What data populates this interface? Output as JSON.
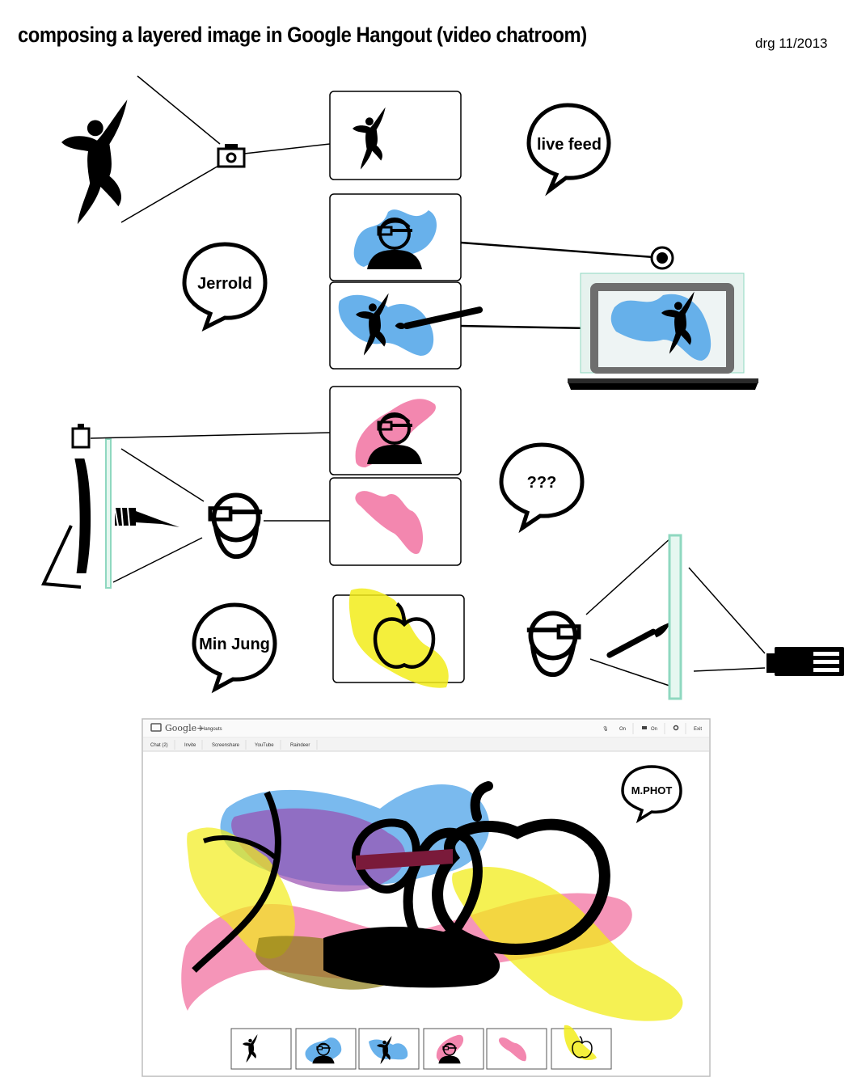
{
  "title": "composing a layered image in Google Hangout (video chatroom)",
  "credit": "drg 11/2013",
  "bubbles": {
    "live_feed": "live feed",
    "jerrold": "Jerrold",
    "unknown": "???",
    "min_jung": "Min Jung",
    "mphot": "M.PHOT"
  },
  "hangout": {
    "brand": "Google+",
    "product": "Hangouts",
    "tabs": [
      "Chat (2)",
      "Invite",
      "Screenshare",
      "YouTube",
      "Raindeer"
    ],
    "controls": {
      "mic": "On",
      "video": "On",
      "exit": "Exit"
    }
  },
  "colors": {
    "blue": "#4da3e8",
    "pink": "#f27aa6",
    "yellow": "#f2ec1a",
    "screen_green": "#8fd8c0",
    "ink": "#000000"
  },
  "icons": [
    "dancer-icon",
    "camera-icon",
    "webcam-icon",
    "laptop-icon",
    "head-with-glasses-icon",
    "paintbrush-icon",
    "apple-icon",
    "monitor-icon",
    "projector-icon"
  ]
}
